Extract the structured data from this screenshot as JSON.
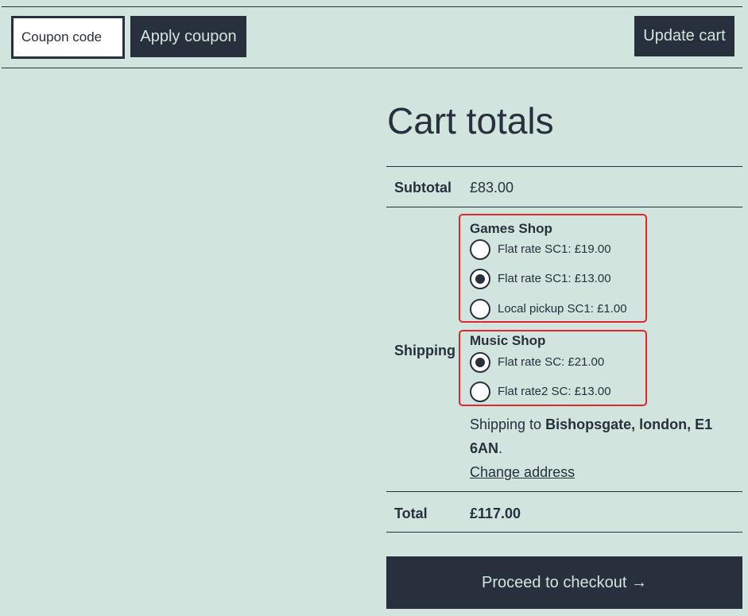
{
  "coupon": {
    "placeholder": "Coupon code",
    "value": "",
    "apply_label": "Apply coupon"
  },
  "cart": {
    "update_label": "Update cart"
  },
  "totals": {
    "title": "Cart totals",
    "subtotal_label": "Subtotal",
    "subtotal_value": "£83.00",
    "shipping_label": "Shipping",
    "shops": [
      {
        "name": "Games Shop",
        "options": [
          {
            "label": "Flat rate SC1: £19.00",
            "checked": false
          },
          {
            "label": "Flat rate SC1: £13.00",
            "checked": true
          },
          {
            "label": "Local pickup SC1: £1.00",
            "checked": false
          }
        ]
      },
      {
        "name": "Music Shop",
        "options": [
          {
            "label": "Flat rate SC: £21.00",
            "checked": true
          },
          {
            "label": "Flat rate2 SC: £13.00",
            "checked": false
          }
        ]
      }
    ],
    "shipping_prefix": "Shipping to",
    "shipping_address": "Bishopsgate, london, E1 6AN",
    "shipping_suffix": ".",
    "change_address": "Change address",
    "total_label": "Total",
    "total_value": "£117.00",
    "checkout_label": "Proceed to checkout →"
  },
  "colors": {
    "background": "#d1e4dd",
    "dark": "#28303d",
    "highlight_border": "#e0262f"
  }
}
